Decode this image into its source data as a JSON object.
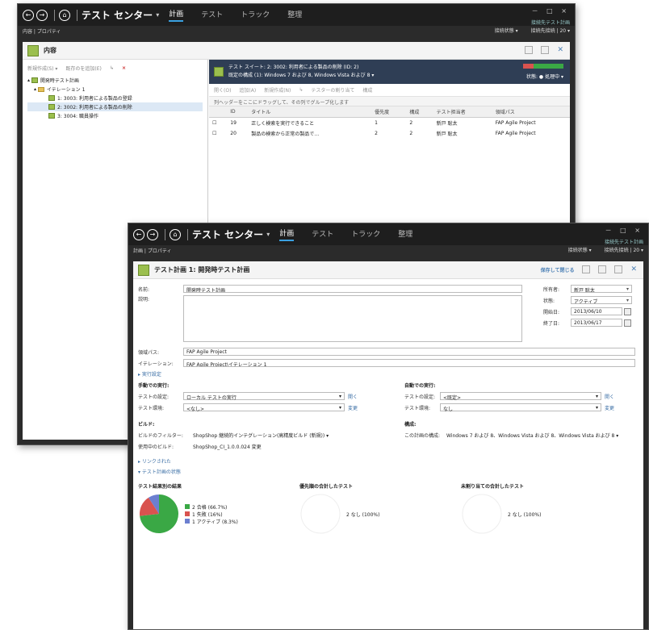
{
  "app": {
    "title": "テスト センター",
    "nav_tabs": [
      "計画",
      "テスト",
      "トラック",
      "整理"
    ],
    "active_tab": "計画",
    "window_controls": "－ □ ×",
    "user_link": "接続先テスト計画"
  },
  "back": {
    "breadcrumb": "内容 | プロパティ",
    "subbar_right": [
      "接続状態 ▾",
      "接続先接続 | 20 ▾"
    ],
    "panel_title": "内容",
    "tree_toolbar": [
      "新規作成(S) ▾",
      "既存のを追加(E)",
      "↳",
      "×"
    ],
    "tree": [
      {
        "label": "開発時テスト計画",
        "level": 0
      },
      {
        "label": "イテレーション 1",
        "level": 1
      },
      {
        "label": "1: 3003: 利用者による製品の登録",
        "level": 2
      },
      {
        "label": "2: 3002: 利用者による製品の削除",
        "level": 2
      },
      {
        "label": "3: 3004: 職員操作",
        "level": 2
      }
    ],
    "suite_line1": "テスト スイート: 2: 3002: 利用者による製品の削除 (ID: 2)",
    "suite_line2": "既定の構成 (1): Windows 7 および 8, Windows Vista および 8 ▾",
    "suite_state": "状態: ● 処理中 ▾",
    "rt_toolbar": [
      "開く(O)",
      "追加(A)",
      "新規作成(N)",
      "↳",
      "テスターの割り当て",
      "構成"
    ],
    "rt_hint": "列ヘッダーをここにドラッグして、その列でグループ化します",
    "table_headers": [
      "",
      "ID",
      "タイトル",
      "優先度",
      "構成",
      "テスト担当者",
      "領域パス"
    ],
    "table_rows": [
      [
        "☐",
        "19",
        "正しく検索を実行できること",
        "1",
        "2",
        "新戸 聡太",
        "FAP Agile Project"
      ],
      [
        "☐",
        "20",
        "製品の検索から正常の製品で…",
        "2",
        "2",
        "新戸 聡太",
        "FAP Agile Project"
      ]
    ]
  },
  "front": {
    "breadcrumb": "計画 | プロパティ",
    "subbar_right": [
      "接続状態 ▾",
      "接続先接続 | 20 ▾"
    ],
    "panel_title": "テスト計画 1: 開発時テスト計画",
    "panel_actions": "保存して閉じる",
    "form": {
      "name_label": "名前:",
      "name_value": "開発時テスト計画",
      "desc_label": "説明:",
      "area_label": "領域パス:",
      "area_value": "FAP Agile Project",
      "iter_label": "イテレーション:",
      "iter_value": "FAP Agile Project\\イテレーション 1",
      "owner_label": "所有者:",
      "owner_value": "新戸 聡太",
      "state_label": "状態:",
      "state_value": "アクティブ",
      "start_label": "開始日:",
      "start_value": "2013/06/10",
      "end_label": "終了日:",
      "end_value": "2013/06/17"
    },
    "run_settings_link": "▸ 実行設定",
    "manual_title": "手動での実行:",
    "auto_title": "自動での実行:",
    "manual_settings_label": "テストの設定:",
    "manual_settings_value": "ローカル テストの実行",
    "manual_env_label": "テスト環境:",
    "manual_env_value": "<なし>",
    "auto_settings_label": "テストの設定:",
    "auto_settings_value": "<既定>",
    "auto_env_label": "テスト環境:",
    "auto_env_value": "なし",
    "open_link": "開く",
    "change_link": "変更",
    "build_title": "ビルド:",
    "build_filter_label": "ビルドのフィルター:",
    "build_filter_value": "ShopShop 継続的インテグレーション(高精度ビルド (新規)) ▾",
    "build_use_label": "使用中のビルド:",
    "build_use_value": "ShopShop_CI_1.0.0.024 変更",
    "config_title": "構成:",
    "config_label": "この計画の構成:",
    "config_value": "Windows 7 および 8、Windows Vista および 8、Windows Vista および 8 ▾",
    "links": [
      "▸ リンクされた",
      "▾ テスト計画の状態"
    ],
    "chart1_title": "テスト結果別の結果",
    "chart2_title": "優先順の合計したテスト",
    "chart3_title": "未割り当ての合計したテスト",
    "chart2_label": "2 なし (100%)",
    "chart3_label": "2 なし (100%)"
  },
  "chart_data": {
    "type": "pie",
    "title": "テスト結果別の結果",
    "categories": [
      "2 合格 (66.7%)",
      "1 失敗 (16%)",
      "1 アクティブ (8.3%)"
    ],
    "values": [
      66.7,
      16,
      8.3
    ],
    "colors": [
      "#3aa845",
      "#d9534f",
      "#6c7fd0"
    ]
  }
}
